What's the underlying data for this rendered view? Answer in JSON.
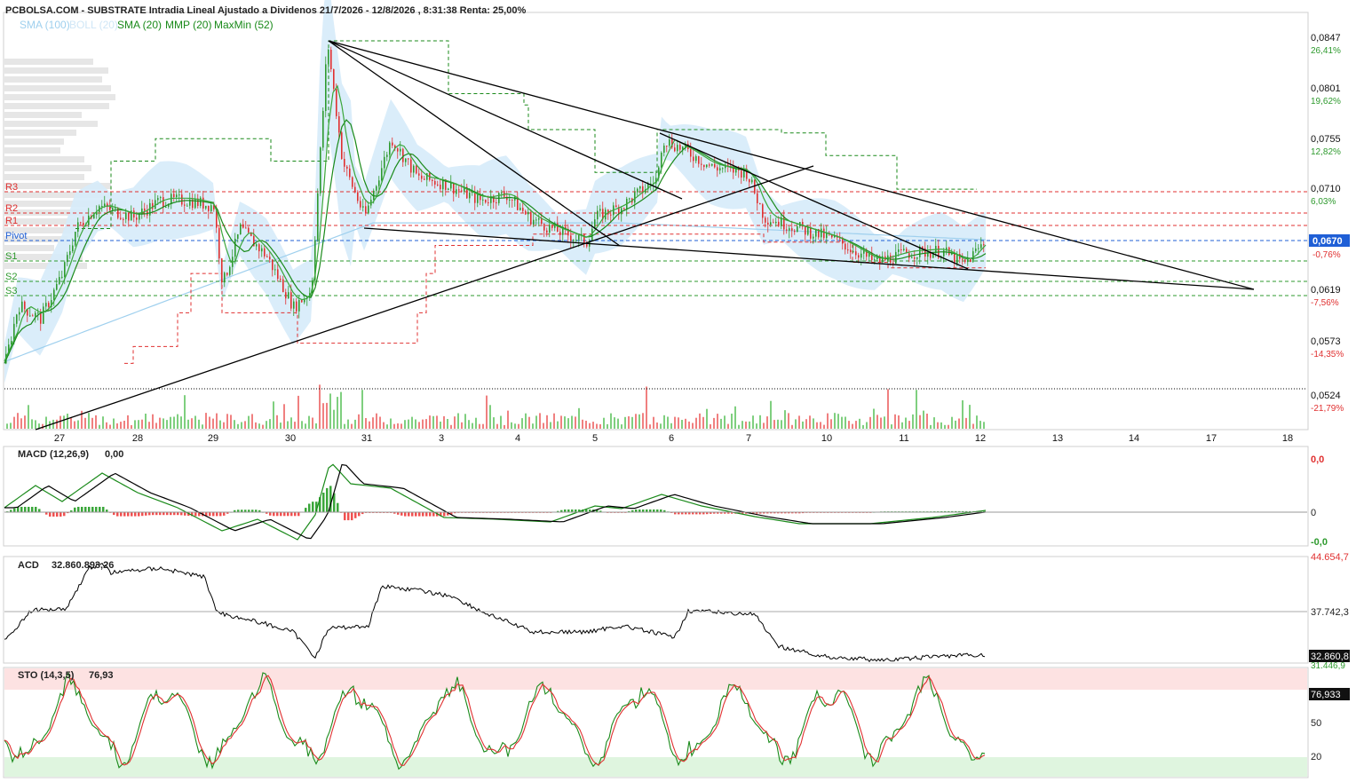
{
  "header": {
    "title": "PCBOLSA.COM - SUBSTRATE Intradia Lineal Ajustado a Dividenos 21/7/2026 - 12/8/2026 , 8:31:38 Renta: 25,00%",
    "legend": [
      {
        "label": "SMA (100)",
        "color": "#9fd0ee"
      },
      {
        "label": "BOLL (20)",
        "color": "#cfe6f6"
      },
      {
        "label": "SMA (20)",
        "color": "#1a8a1a"
      },
      {
        "label": "MMP (20)",
        "color": "#1a8a1a"
      },
      {
        "label": "MaxMin (52)",
        "color": "#1a8a1a"
      }
    ]
  },
  "colors": {
    "up": "#2e9a2e",
    "down": "#e03030",
    "boll_fill": "#d6ebfa",
    "pivot": "#1f5fd6",
    "resistance": "#e03030",
    "support": "#2e9a2e"
  },
  "levels": [
    {
      "label": "R3",
      "value": 0.071,
      "color": "#e03030"
    },
    {
      "label": "R2",
      "value": 0.069,
      "color": "#e03030"
    },
    {
      "label": "R1",
      "value": 0.068,
      "color": "#e03030"
    },
    {
      "label": "Pivot",
      "value": 0.067,
      "color": "#1f5fd6"
    },
    {
      "label": "S1",
      "value": 0.0654,
      "color": "#2e9a2e"
    },
    {
      "label": "S2",
      "value": 0.0632,
      "color": "#2e9a2e"
    },
    {
      "label": "S3",
      "value": 0.062,
      "color": "#2e9a2e"
    }
  ],
  "price_axis": {
    "ticks": [
      {
        "value": "0,0847",
        "pct": "26,41%"
      },
      {
        "value": "0,0801",
        "pct": "19,62%"
      },
      {
        "value": "0,0755",
        "pct": "12,82%"
      },
      {
        "value": "0,0710",
        "pct": "6,03%"
      },
      {
        "value": "0,0670",
        "pct": "-0,76%"
      },
      {
        "value": "0,0619",
        "pct": "-7,56%"
      },
      {
        "value": "0,0573",
        "pct": "-14,35%"
      },
      {
        "value": "0,0524",
        "pct": "-21,79%"
      }
    ],
    "current": "0,0670"
  },
  "x_axis": {
    "labels": [
      "27",
      "28",
      "29",
      "30",
      "31",
      "3",
      "4",
      "5",
      "6",
      "7",
      "10",
      "11",
      "12",
      "13",
      "14",
      "17",
      "18"
    ]
  },
  "macd": {
    "title": "MACD (12,26,9)",
    "value": "0,00",
    "ticks": [
      "0,0",
      "0",
      "-0,0"
    ]
  },
  "acd": {
    "title": "ACD",
    "value": "32.860.893,26",
    "ticks": [
      "44.654,7",
      "37.742,3",
      "31.446,9"
    ],
    "current": "32.860,8"
  },
  "sto": {
    "title": "STO (14,3,5)",
    "value": "76,93",
    "ticks": [
      "50",
      "20"
    ],
    "current": "76,933"
  },
  "chart_data": {
    "type": "candlestick",
    "title": "PCBOLSA.COM - SUBSTRATE Intradia Lineal Ajustado a Dividenos 21/7/2026 - 12/8/2026 , 8:31:38 Renta: 25,00%",
    "x": [
      "27",
      "28",
      "29",
      "30",
      "31",
      "3",
      "4",
      "5",
      "6",
      "7",
      "10",
      "11",
      "12"
    ],
    "close": [
      0.062,
      0.0695,
      0.07,
      0.06,
      0.076,
      0.0725,
      0.0705,
      0.0665,
      0.0755,
      0.073,
      0.0678,
      0.0662,
      0.067
    ],
    "high": [
      0.064,
      0.072,
      0.072,
      0.065,
      0.0847,
      0.077,
      0.0735,
      0.073,
      0.0765,
      0.075,
      0.07,
      0.068,
      0.0678
    ],
    "low": [
      0.054,
      0.062,
      0.06,
      0.0575,
      0.064,
      0.07,
      0.066,
      0.065,
      0.07,
      0.068,
      0.0655,
      0.0645,
      0.0648
    ],
    "ylim": [
      0.05,
      0.087
    ],
    "grid": false
  }
}
